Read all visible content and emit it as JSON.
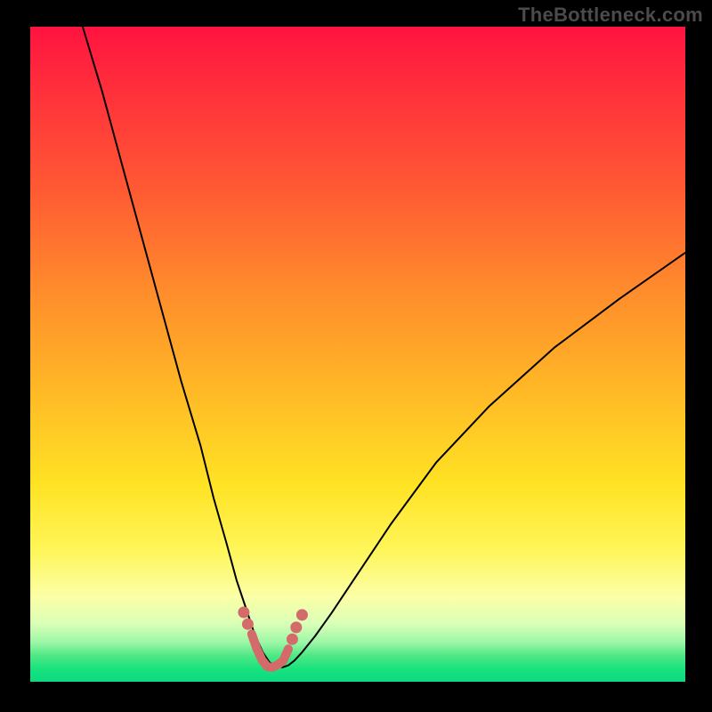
{
  "watermark": "TheBottleneck.com",
  "colors": {
    "frame_bg": "#000000",
    "watermark": "#4b4b4b",
    "curve": "#000000",
    "accent_path": "#d36b6a",
    "dot": "#d36b6a",
    "gradient_top": "#ff1340",
    "gradient_bottom": "#0cd981"
  },
  "chart_data": {
    "type": "line",
    "title": "",
    "xlabel": "",
    "ylabel": "",
    "xlim": [
      0,
      100
    ],
    "ylim": [
      0,
      100
    ],
    "grid": false,
    "legend": false,
    "note": "Single V-shaped bottleneck curve; x is approximate horizontal percent of plot area, y is percent from bottom (0=bottom, 100=top). Valley floor rendered as salmon path with dots.",
    "series": [
      {
        "name": "bottleneck-curve",
        "x": [
          8,
          11,
          14,
          17,
          20,
          23,
          26,
          28,
          30,
          31.5,
          33,
          34,
          34.6,
          35.5,
          36.5,
          37.5,
          38.5,
          39.4,
          40.3,
          41.5,
          43.5,
          46,
          50,
          55,
          62,
          70,
          80,
          90,
          100
        ],
        "y": [
          100,
          90,
          79,
          68,
          57,
          46,
          36,
          28,
          21,
          15.5,
          11,
          8,
          6.5,
          4.5,
          3,
          2.3,
          2.2,
          2.5,
          3.2,
          4.5,
          7,
          10.5,
          16.5,
          24,
          33.5,
          42,
          51,
          58.5,
          65.5
        ]
      }
    ],
    "accent_segment": {
      "name": "valley-floor",
      "x": [
        33.8,
        34.6,
        35.4,
        36.2,
        37.0,
        37.8,
        38.6,
        39.4
      ],
      "y": [
        7.3,
        5.0,
        3.3,
        2.3,
        2.2,
        2.6,
        3.2,
        5.0
      ]
    },
    "dots": {
      "name": "valley-dots",
      "points": [
        {
          "x": 32.6,
          "y": 10.6
        },
        {
          "x": 33.2,
          "y": 8.8
        },
        {
          "x": 40.0,
          "y": 6.5
        },
        {
          "x": 40.6,
          "y": 8.3
        },
        {
          "x": 41.5,
          "y": 10.2
        }
      ]
    }
  }
}
